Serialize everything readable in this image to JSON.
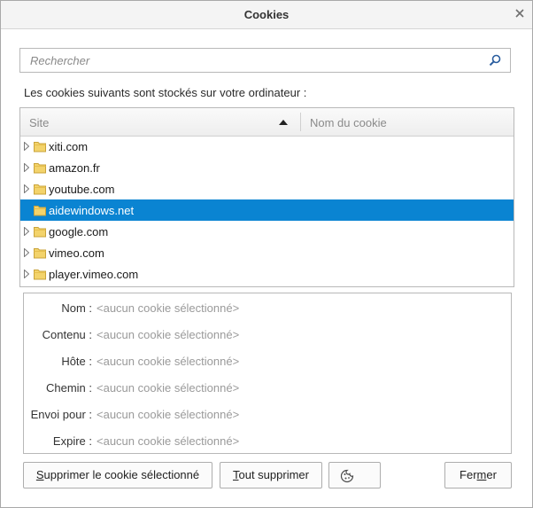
{
  "window": {
    "title": "Cookies"
  },
  "search": {
    "placeholder": "Rechercher",
    "value": ""
  },
  "intro_text": "Les cookies suivants sont stockés sur votre ordinateur :",
  "tree": {
    "columns": {
      "site": "Site",
      "cookie_name": "Nom du cookie",
      "sort_direction": "ascending"
    },
    "rows": [
      {
        "label": "xiti.com",
        "selected": false
      },
      {
        "label": "amazon.fr",
        "selected": false
      },
      {
        "label": "youtube.com",
        "selected": false
      },
      {
        "label": "aidewindows.net",
        "selected": true
      },
      {
        "label": "google.com",
        "selected": false
      },
      {
        "label": "vimeo.com",
        "selected": false
      },
      {
        "label": "player.vimeo.com",
        "selected": false
      }
    ]
  },
  "details": [
    {
      "label": "Nom :",
      "value": "<aucun cookie sélectionné>"
    },
    {
      "label": "Contenu :",
      "value": "<aucun cookie sélectionné>"
    },
    {
      "label": "Hôte :",
      "value": "<aucun cookie sélectionné>"
    },
    {
      "label": "Chemin :",
      "value": "<aucun cookie sélectionné>"
    },
    {
      "label": "Envoi pour :",
      "value": "<aucun cookie sélectionné>"
    },
    {
      "label": "Expire :",
      "value": "<aucun cookie sélectionné>"
    }
  ],
  "buttons": {
    "remove_selected": {
      "accesskey": "S",
      "rest": "upprimer le cookie sélectionné"
    },
    "remove_all": {
      "accesskey": "T",
      "rest": "out supprimer"
    },
    "close": {
      "before": "Fer",
      "accesskey": "m",
      "after": "er"
    }
  },
  "colors": {
    "selection": "#0a84d2",
    "folder": "#f3d36b",
    "accent": "#0a84d2"
  }
}
